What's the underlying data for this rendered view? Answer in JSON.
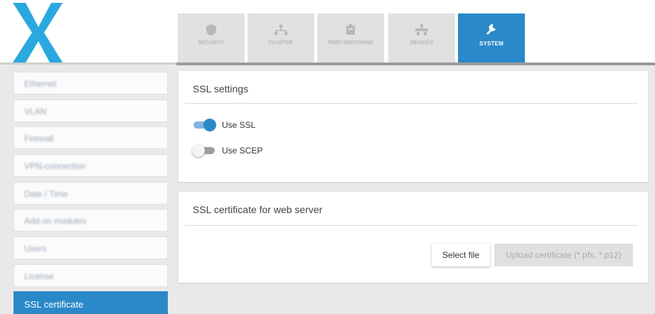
{
  "nav": {
    "tabs": [
      {
        "label": "SECURITY",
        "icon": "shield-icon",
        "active": false
      },
      {
        "label": "CLUSTER",
        "icon": "network-icon",
        "active": false
      },
      {
        "label": "PORT-SWITCHING",
        "icon": "puzzle-icon",
        "active": false
      },
      {
        "label": "DEVICES",
        "icon": "devices-icon",
        "active": false
      },
      {
        "label": "SYSTEM",
        "icon": "wrench-icon",
        "active": true
      }
    ]
  },
  "sidebar": {
    "items": [
      {
        "label": "Ethernet",
        "active": false
      },
      {
        "label": "VLAN",
        "active": false
      },
      {
        "label": "Firewall",
        "active": false
      },
      {
        "label": "VPN-connection",
        "active": false
      },
      {
        "label": "Date / Time",
        "active": false
      },
      {
        "label": "Add-on modules",
        "active": false
      },
      {
        "label": "Users",
        "active": false
      },
      {
        "label": "License",
        "active": false
      },
      {
        "label": "SSL certificate",
        "active": true
      }
    ]
  },
  "ssl_settings": {
    "title": "SSL settings",
    "use_ssl": {
      "label": "Use SSL",
      "checked": true
    },
    "use_scep": {
      "label": "Use SCEP",
      "checked": false
    }
  },
  "certificate": {
    "title": "SSL certificate for web server",
    "select_label": "Select file",
    "upload_label": "Upload certificate (*.pfx, *.p12)"
  },
  "colors": {
    "accent": "#2a89c8",
    "logo": "#29a9df",
    "background": "#e9e9e9"
  }
}
